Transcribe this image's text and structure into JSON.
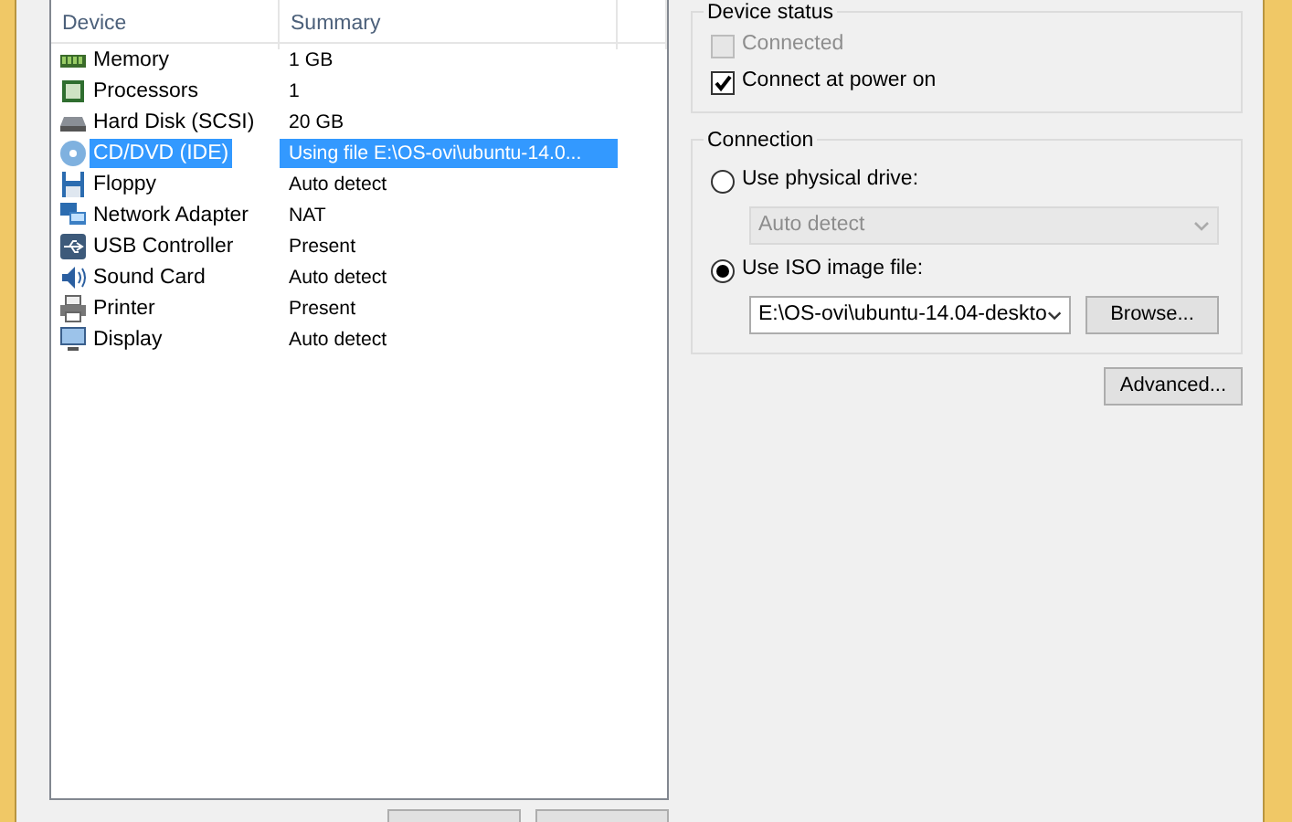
{
  "device_list": {
    "columns": [
      "Device",
      "Summary"
    ],
    "rows": [
      {
        "kind": "memory",
        "device": "Memory",
        "summary": "1 GB",
        "selected": false
      },
      {
        "kind": "processor",
        "device": "Processors",
        "summary": "1",
        "selected": false
      },
      {
        "kind": "disk",
        "device": "Hard Disk (SCSI)",
        "summary": "20 GB",
        "selected": false
      },
      {
        "kind": "cd",
        "device": "CD/DVD (IDE)",
        "summary": "Using file E:\\OS-ovi\\ubuntu-14.0...",
        "selected": true
      },
      {
        "kind": "floppy",
        "device": "Floppy",
        "summary": "Auto detect",
        "selected": false
      },
      {
        "kind": "network",
        "device": "Network Adapter",
        "summary": "NAT",
        "selected": false
      },
      {
        "kind": "usb",
        "device": "USB Controller",
        "summary": "Present",
        "selected": false
      },
      {
        "kind": "sound",
        "device": "Sound Card",
        "summary": "Auto detect",
        "selected": false
      },
      {
        "kind": "printer",
        "device": "Printer",
        "summary": "Present",
        "selected": false
      },
      {
        "kind": "display",
        "device": "Display",
        "summary": "Auto detect",
        "selected": false
      }
    ]
  },
  "device_status": {
    "title": "Device status",
    "options": [
      {
        "label": "Connected",
        "checked": false,
        "disabled": true
      },
      {
        "label": "Connect at power on",
        "checked": true,
        "disabled": false
      }
    ]
  },
  "connection": {
    "title": "Connection",
    "options": [
      {
        "label": "Use physical drive:",
        "selected": false,
        "field": {
          "value": "Auto detect",
          "disabled": true
        }
      },
      {
        "label": "Use ISO image file:",
        "selected": true,
        "field": {
          "value": "E:\\OS-ovi\\ubuntu-14.04-deskto",
          "disabled": false
        },
        "button": "Browse..."
      }
    ]
  },
  "advanced_button": "Advanced..."
}
